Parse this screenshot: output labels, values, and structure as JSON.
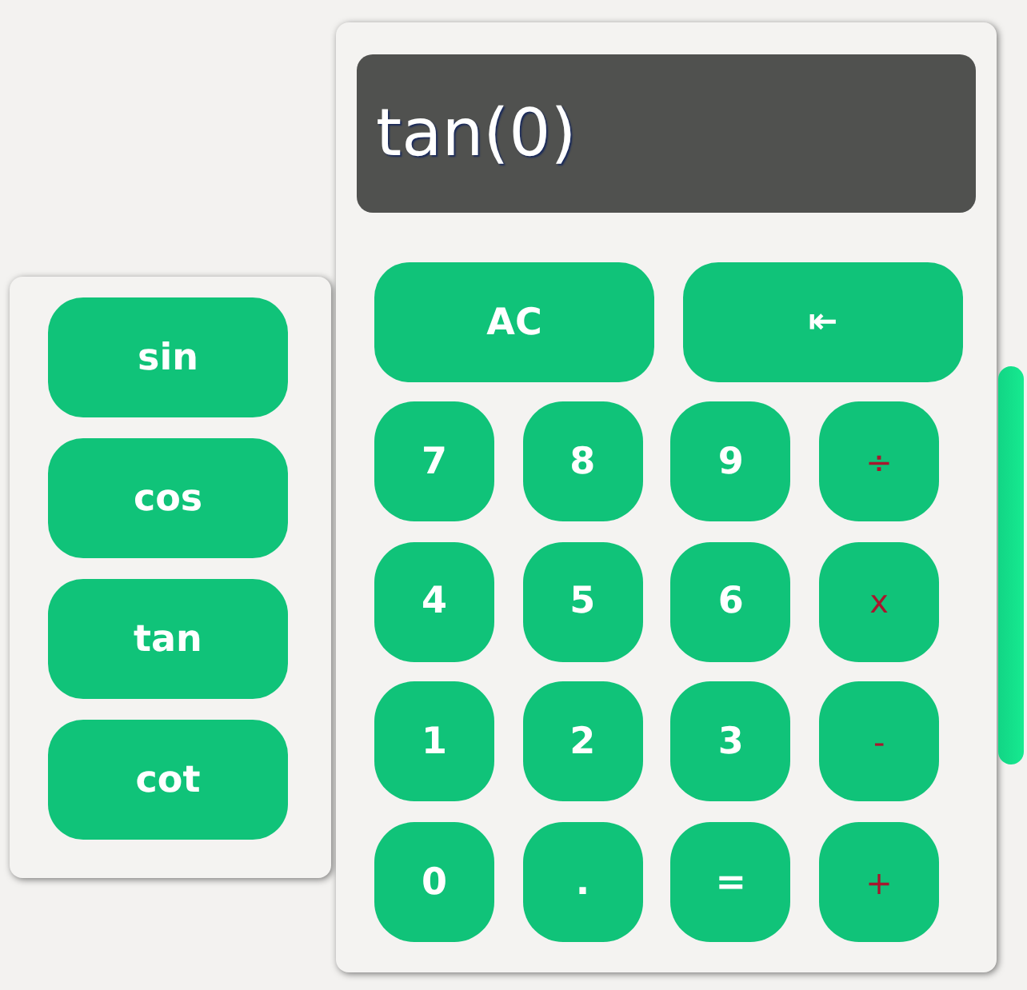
{
  "functions": [
    {
      "label": "sin"
    },
    {
      "label": "cos"
    },
    {
      "label": "tan"
    },
    {
      "label": "cot"
    }
  ],
  "display": {
    "value": "tan(0)"
  },
  "controls": [
    {
      "label": "AC",
      "kind": "clear"
    },
    {
      "label": "⇤",
      "kind": "backspace"
    }
  ],
  "keys": [
    {
      "label": "7",
      "kind": "digit"
    },
    {
      "label": "8",
      "kind": "digit"
    },
    {
      "label": "9",
      "kind": "digit"
    },
    {
      "label": "÷",
      "kind": "operator"
    },
    {
      "label": "4",
      "kind": "digit"
    },
    {
      "label": "5",
      "kind": "digit"
    },
    {
      "label": "6",
      "kind": "digit"
    },
    {
      "label": "x",
      "kind": "operator"
    },
    {
      "label": "1",
      "kind": "digit"
    },
    {
      "label": "2",
      "kind": "digit"
    },
    {
      "label": "3",
      "kind": "digit"
    },
    {
      "label": "-",
      "kind": "operator"
    },
    {
      "label": "0",
      "kind": "digit"
    },
    {
      "label": ".",
      "kind": "point"
    },
    {
      "label": "=",
      "kind": "equals"
    },
    {
      "label": "+",
      "kind": "operator"
    }
  ]
}
